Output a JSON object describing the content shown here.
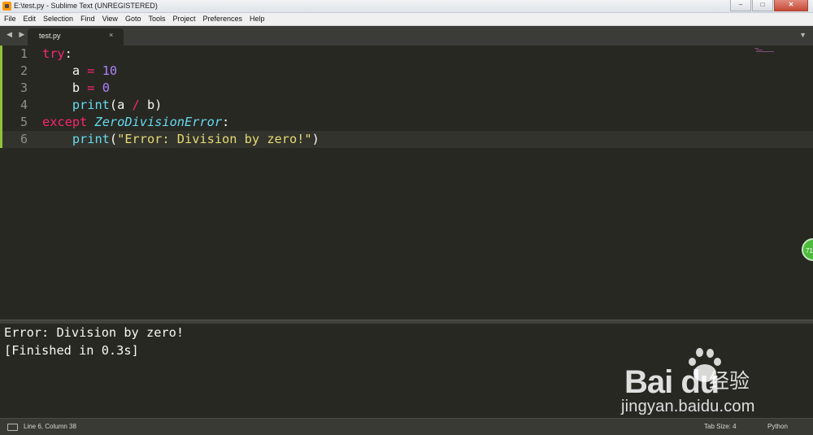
{
  "window": {
    "title": "E:\\test.py - Sublime Text (UNREGISTERED)",
    "minimize": "0",
    "maximize": "1",
    "close": "r"
  },
  "menu": [
    "File",
    "Edit",
    "Selection",
    "Find",
    "View",
    "Goto",
    "Tools",
    "Project",
    "Preferences",
    "Help"
  ],
  "tabs": {
    "nav_arrows": "◀ ▶",
    "active": {
      "label": "test.py",
      "close": "×"
    },
    "dropdown": "▼"
  },
  "editor": {
    "line_numbers": [
      "1",
      "2",
      "3",
      "4",
      "5",
      "6"
    ],
    "lines": [
      [
        {
          "t": "try",
          "c": "kw"
        },
        {
          "t": ":",
          "c": ""
        }
      ],
      [
        {
          "t": "    a ",
          "c": ""
        },
        {
          "t": "=",
          "c": "kw"
        },
        {
          "t": " ",
          "c": ""
        },
        {
          "t": "10",
          "c": "num"
        }
      ],
      [
        {
          "t": "    b ",
          "c": ""
        },
        {
          "t": "=",
          "c": "kw"
        },
        {
          "t": " ",
          "c": ""
        },
        {
          "t": "0",
          "c": "num"
        }
      ],
      [
        {
          "t": "    ",
          "c": ""
        },
        {
          "t": "print",
          "c": "fn"
        },
        {
          "t": "(a ",
          "c": ""
        },
        {
          "t": "/",
          "c": "kw"
        },
        {
          "t": " b)",
          "c": ""
        }
      ],
      [
        {
          "t": "except",
          "c": "kw"
        },
        {
          "t": " ",
          "c": ""
        },
        {
          "t": "ZeroDivisionError",
          "c": "cls"
        },
        {
          "t": ":",
          "c": ""
        }
      ],
      [
        {
          "t": "    ",
          "c": ""
        },
        {
          "t": "print",
          "c": "fn"
        },
        {
          "t": "(",
          "c": ""
        },
        {
          "t": "\"Error: Division by zero!\"",
          "c": "str"
        },
        {
          "t": ")",
          "c": ""
        }
      ]
    ],
    "current_line": 6
  },
  "badge": "71",
  "output": [
    "Error: Division by zero!",
    "[Finished in 0.3s]"
  ],
  "watermark": {
    "brand": "Bai du",
    "chinese": "经验",
    "url": "jingyan.baidu.com"
  },
  "status": {
    "position": "Line 6, Column 38",
    "tab_size": "Tab Size: 4",
    "syntax": "Python"
  },
  "colors": {
    "background": "#272822",
    "keyword": "#f92672",
    "number": "#ae81ff",
    "function": "#66d9ef",
    "string": "#e6db74",
    "text": "#f8f8f2",
    "gutter_marker": "#8fc337"
  }
}
